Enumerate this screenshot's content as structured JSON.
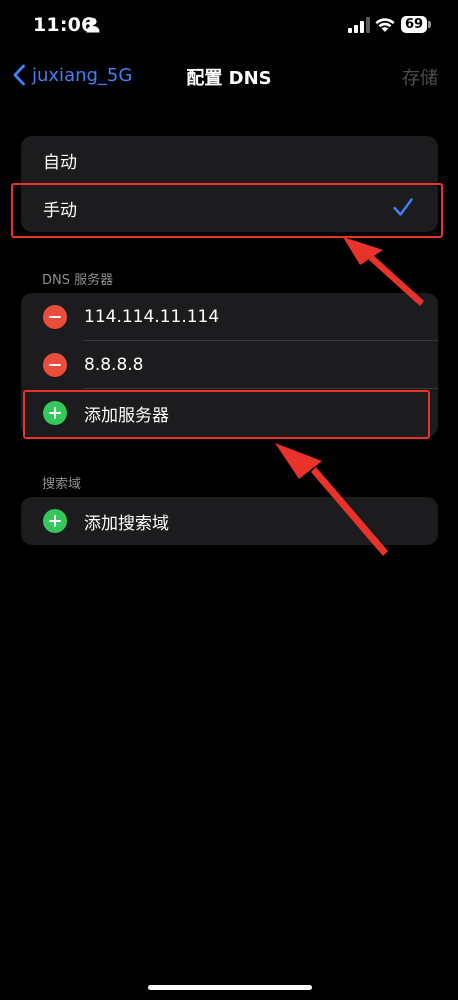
{
  "status": {
    "time": "11:06",
    "battery": "69"
  },
  "nav": {
    "back_label": "juxiang_5G",
    "title": "配置 DNS",
    "save_label": "存储"
  },
  "mode": {
    "options": [
      {
        "label": "自动",
        "selected": false
      },
      {
        "label": "手动",
        "selected": true
      }
    ]
  },
  "dns": {
    "header": "DNS 服务器",
    "servers": [
      "114.114.11.114",
      "8.8.8.8"
    ],
    "add_label": "添加服务器"
  },
  "search": {
    "header": "搜索域",
    "add_label": "添加搜索域"
  },
  "colors": {
    "accent": "#3b82f6",
    "destructive": "#eb4d3d",
    "add": "#34c759",
    "annotation": "#e8322a"
  }
}
